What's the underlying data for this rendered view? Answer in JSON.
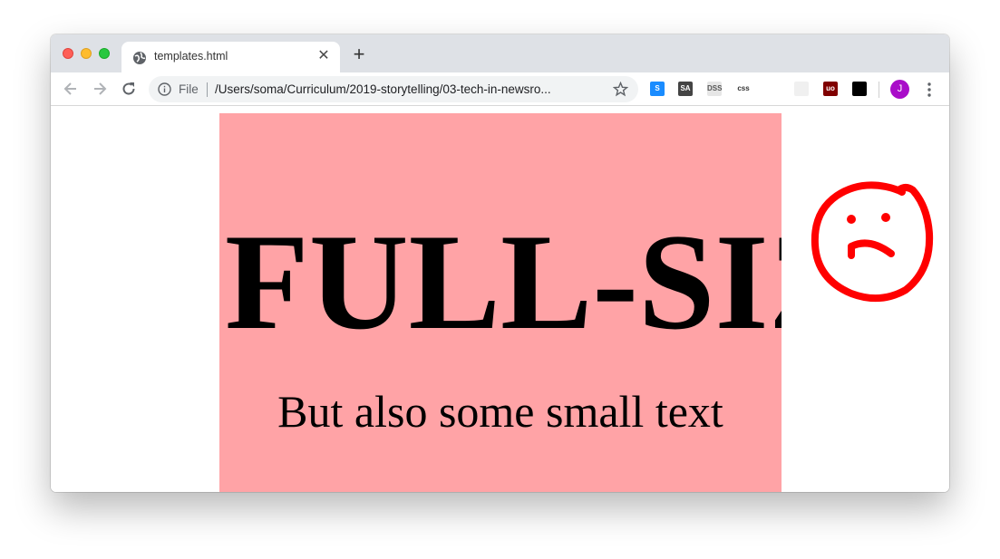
{
  "browser": {
    "tab": {
      "title": "templates.html",
      "close_glyph": "✕"
    },
    "new_tab_glyph": "+",
    "address_bar": {
      "scheme_label": "File",
      "url": "/Users/soma/Curriculum/2019-storytelling/03-tech-in-newsro..."
    },
    "extensions": [
      {
        "icon": "s-extension-icon",
        "label": "S",
        "bg": "#1a8cff",
        "fg": "#ffffff"
      },
      {
        "icon": "sa-extension-icon",
        "label": "SA",
        "bg": "#444444",
        "fg": "#ffffff"
      },
      {
        "icon": "css-selector-extension-icon",
        "label": "DSS",
        "bg": "#e6e6e6",
        "fg": "#555555"
      },
      {
        "icon": "css-extension-icon",
        "label": "css",
        "bg": "#ffffff",
        "fg": "#333333"
      },
      {
        "icon": "globe-extension-icon",
        "label": "",
        "bg": "#ffffff",
        "fg": "#888888"
      },
      {
        "icon": "grid-extension-icon",
        "label": "",
        "bg": "#f0f0f0",
        "fg": "#bbbbbb"
      },
      {
        "icon": "ublock-extension-icon",
        "label": "uo",
        "bg": "#800000",
        "fg": "#ffffff"
      },
      {
        "icon": "tampermonkey-extension-icon",
        "label": "",
        "bg": "#000000",
        "fg": "#ffffff"
      }
    ],
    "profile_initial": "J",
    "colors": {
      "tabstrip": "#dee1e6",
      "avatar": "#a90dc9"
    }
  },
  "page": {
    "heading": "FULL-SIZE",
    "subtext": "But also some small text",
    "box_color": "#ffa3a6",
    "annotation": {
      "icon": "sad-face-icon",
      "color": "#ff0000"
    }
  }
}
